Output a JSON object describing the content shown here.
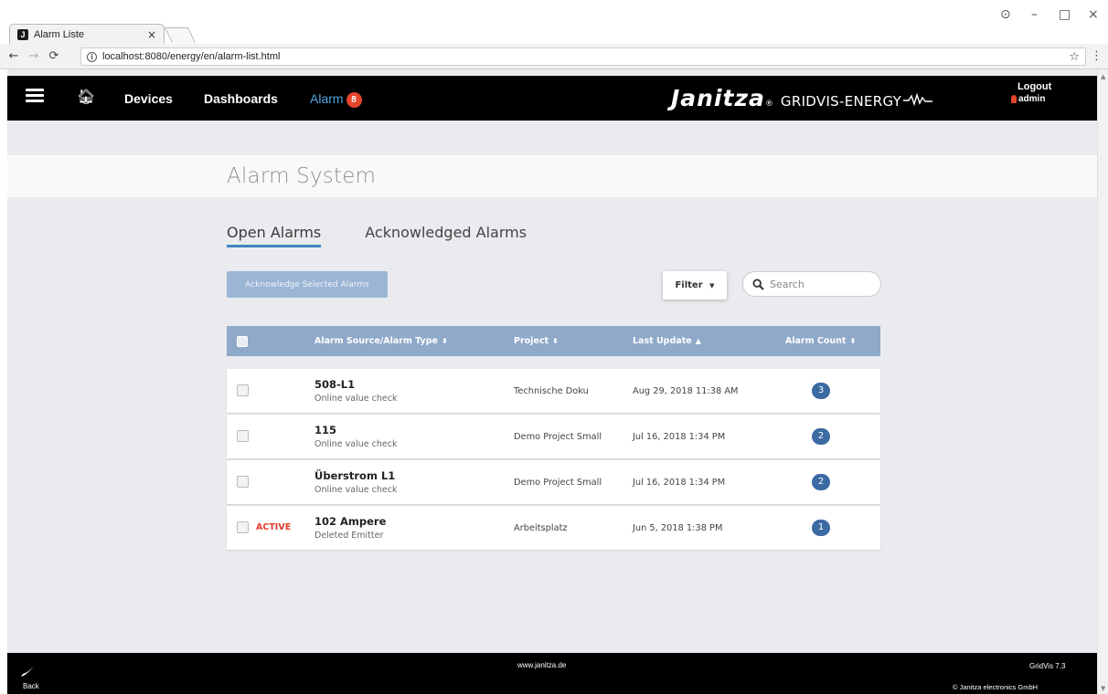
{
  "browser": {
    "tab_title": "Alarm Liste",
    "tab_close": "×",
    "favicon_letter": "J",
    "url": "localhost:8080/energy/en/alarm-list.html",
    "window_controls": {
      "profile": "⊙",
      "minimize": "–",
      "maximize": "□",
      "close": "×"
    }
  },
  "header": {
    "nav": {
      "devices": "Devices",
      "dashboards": "Dashboards",
      "alarm": "Alarm",
      "alarm_count": "8"
    },
    "brand": {
      "name": "Janitza",
      "registered": "®",
      "product": "GRIDVIS-ENERGY"
    },
    "user": {
      "logout": "Logout",
      "username": "admin"
    }
  },
  "page": {
    "title": "Alarm System",
    "tabs": [
      {
        "label": "Open Alarms",
        "selected": true
      },
      {
        "label": "Acknowledged Alarms",
        "selected": false
      }
    ],
    "acknowledge_button": "Acknowledge Selected Alarms",
    "filter_button": "Filter",
    "search_placeholder": "Search"
  },
  "table": {
    "columns": [
      {
        "label": "Alarm Source/Alarm Type",
        "sort": "⬍"
      },
      {
        "label": "Project",
        "sort": "⬍"
      },
      {
        "label": "Last Update",
        "sort": "▲"
      },
      {
        "label": "Alarm Count",
        "sort": "⬍"
      }
    ],
    "rows": [
      {
        "status": "",
        "source": "508-L1",
        "type": "Online value check",
        "project": "Technische Doku",
        "updated": "Aug 29, 2018 11:38 AM",
        "count": "3"
      },
      {
        "status": "",
        "source": "115",
        "type": "Online value check",
        "project": "Demo Project Small",
        "updated": "Jul 16, 2018 1:34 PM",
        "count": "2"
      },
      {
        "status": "",
        "source": "Überstrom L1",
        "type": "Online value check",
        "project": "Demo Project Small",
        "updated": "Jul 16, 2018 1:34 PM",
        "count": "2"
      },
      {
        "status": "ACTIVE",
        "source": "102 Ampere",
        "type": "Deleted Emitter",
        "project": "Arbeitsplatz",
        "updated": "Jun 5, 2018 1:38 PM",
        "count": "1"
      }
    ]
  },
  "footer": {
    "back": "Back",
    "url": "www.janitza.de",
    "version": "GridVis 7.3",
    "copyright": "© Janitza electronics GmbH"
  },
  "colors": {
    "accent": "#4282c2",
    "header_bg": "#000000",
    "badge_red": "#e5452b",
    "table_header": "#8fa9c9",
    "count_badge": "#3c6aa3",
    "active_red": "#e23b2a"
  },
  "icons": {
    "menu": "hamburger-icon",
    "home": "home-icon",
    "search": "search-icon",
    "back": "back-swoosh-icon",
    "user": "user-icon"
  }
}
